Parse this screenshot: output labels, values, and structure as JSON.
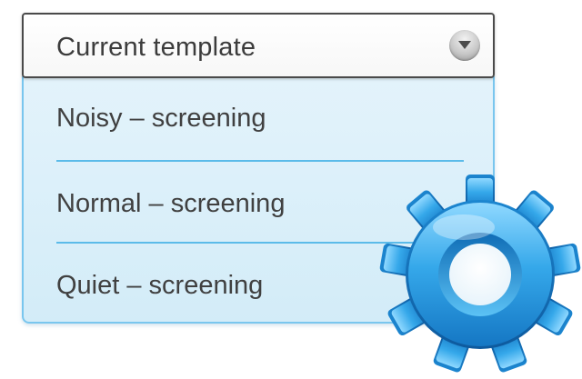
{
  "dropdown": {
    "selected_label": "Current template",
    "chevron_icon": "chevron-down-icon",
    "options": [
      {
        "label": "Noisy – screening"
      },
      {
        "label": "Normal – screening"
      },
      {
        "label": "Quiet – screening"
      }
    ]
  },
  "decoration": {
    "gear_icon": "gear-icon",
    "gear_color": "#2f9be0"
  },
  "colors": {
    "list_background": "#dff1fa",
    "list_border": "#79c6ee",
    "divider": "#5bbbe9",
    "select_border": "#4a4a4a"
  }
}
